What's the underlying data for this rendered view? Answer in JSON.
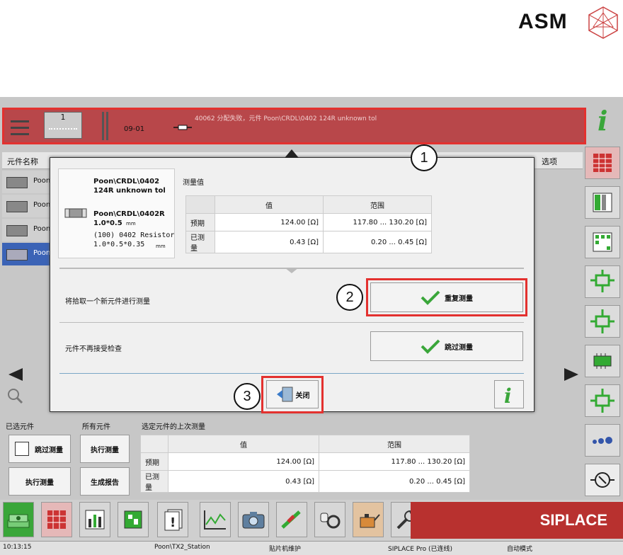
{
  "brand": {
    "logo_text": "ASM",
    "footer_brand": "SIPLACE"
  },
  "statusbar": {
    "feeder_index": "1",
    "track": "09-01",
    "message": "40062 分配失败，元件 Poon\\CRDL\\0402 124R unknown tol"
  },
  "table": {
    "col_component_name": "元件名称",
    "col_options": "选项",
    "rows": [
      {
        "name": "Poon"
      },
      {
        "name": "Poon"
      },
      {
        "name": "Poon"
      },
      {
        "name": "Poon"
      }
    ]
  },
  "dialog": {
    "part_name": "Poon\\CRDL\\0402\n124R unknown tol",
    "part_package": "Poon\\CRDL\\0402R\n1.0*0.5",
    "part_unit": "mm",
    "part_desc": "(100) 0402 Resistor\n1.0*0.5*0.35",
    "part_desc_unit": "mm",
    "measured_title": "测量值",
    "col_value": "值",
    "col_range": "范围",
    "rows": [
      {
        "label": "预期",
        "value": "124.00 [Ω]",
        "range": "117.80 ... 130.20 [Ω]"
      },
      {
        "label": "已测量",
        "value": "0.43 [Ω]",
        "range": "0.20 ... 0.45 [Ω]"
      }
    ],
    "option1_text": "将拾取一个新元件进行测量",
    "option1_button": "重复测量",
    "option2_text": "元件不再接受检查",
    "option2_button": "跳过测量",
    "close_button": "关闭"
  },
  "callouts": [
    "1",
    "2",
    "3"
  ],
  "bottom": {
    "selected_parts": "已选元件",
    "all_parts": "所有元件",
    "last_measure": "选定元件的上次测量",
    "skip_measure": "跳过测量",
    "exec_measure": "执行测量",
    "exec_measure2": "执行测量",
    "gen_report": "生成报告",
    "col_value": "值",
    "col_range": "范围",
    "rows": [
      {
        "label": "预期",
        "value": "124.00 [Ω]",
        "range": "117.80 ... 130.20 [Ω]"
      },
      {
        "label": "已测量",
        "value": "0.43 [Ω]",
        "range": "0.20 ... 0.45 [Ω]"
      }
    ]
  },
  "footer": {
    "time": "10:13:15",
    "station": "Poon\\TX2_Station",
    "mode1": "贴片机维护",
    "connection": "SIPLACE Pro (已连线)",
    "mode2": "自动模式"
  },
  "colors": {
    "alert_red": "#b8474a",
    "highlight": "#e3312f",
    "accent_green": "#3aa63a"
  }
}
